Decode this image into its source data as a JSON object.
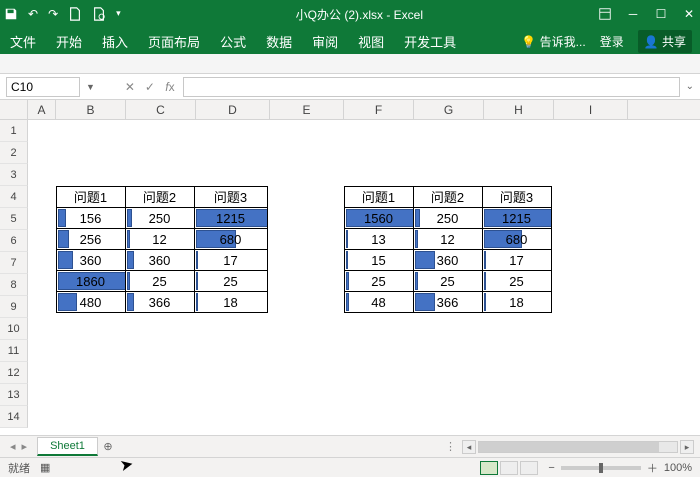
{
  "window": {
    "title": "小Q办公 (2).xlsx - Excel"
  },
  "ribbon": {
    "tabs": [
      "文件",
      "开始",
      "插入",
      "页面布局",
      "公式",
      "数据",
      "审阅",
      "视图",
      "开发工具"
    ],
    "tellme": "告诉我...",
    "login": "登录",
    "share": "共享"
  },
  "namebox": {
    "cell": "C10"
  },
  "columns": [
    "A",
    "B",
    "C",
    "D",
    "E",
    "F",
    "G",
    "H",
    "I"
  ],
  "rows": [
    "1",
    "2",
    "3",
    "4",
    "5",
    "6",
    "7",
    "8",
    "9",
    "10",
    "11",
    "12",
    "13",
    "14"
  ],
  "table1": {
    "headers": [
      "问题1",
      "问题2",
      "问题3"
    ],
    "data": [
      {
        "v": [
          156,
          250,
          1215
        ],
        "bar": [
          0.12,
          0.08,
          1.0
        ]
      },
      {
        "v": [
          256,
          12,
          680
        ],
        "bar": [
          0.16,
          0.04,
          0.56
        ]
      },
      {
        "v": [
          360,
          360,
          17
        ],
        "bar": [
          0.22,
          0.1,
          0.03
        ]
      },
      {
        "v": [
          1860,
          25,
          25
        ],
        "bar": [
          1.0,
          0.05,
          0.03
        ]
      },
      {
        "v": [
          480,
          366,
          18
        ],
        "bar": [
          0.28,
          0.1,
          0.03
        ]
      }
    ]
  },
  "table2": {
    "headers": [
      "问题1",
      "问题2",
      "问题3"
    ],
    "data": [
      {
        "v": [
          1560,
          250,
          1215
        ],
        "bar": [
          1.0,
          0.08,
          1.0
        ]
      },
      {
        "v": [
          13,
          12,
          680
        ],
        "bar": [
          0.03,
          0.04,
          0.56
        ]
      },
      {
        "v": [
          15,
          360,
          17
        ],
        "bar": [
          0.03,
          0.3,
          0.03
        ]
      },
      {
        "v": [
          25,
          25,
          25
        ],
        "bar": [
          0.04,
          0.05,
          0.03
        ]
      },
      {
        "v": [
          48,
          366,
          18
        ],
        "bar": [
          0.05,
          0.3,
          0.03
        ]
      }
    ]
  },
  "sheet": {
    "name": "Sheet1"
  },
  "status": {
    "ready": "就绪",
    "zoom": "100%"
  },
  "chart_data": [
    {
      "type": "table",
      "title": "Table 1 (B4:D9) with in-cell data bars",
      "series": [
        {
          "name": "问题1",
          "values": [
            156,
            256,
            360,
            1860,
            480
          ]
        },
        {
          "name": "问题2",
          "values": [
            250,
            12,
            360,
            25,
            366
          ]
        },
        {
          "name": "问题3",
          "values": [
            1215,
            680,
            17,
            25,
            18
          ]
        }
      ]
    },
    {
      "type": "table",
      "title": "Table 2 (F4:H9) with in-cell data bars",
      "series": [
        {
          "name": "问题1",
          "values": [
            1560,
            13,
            15,
            25,
            48
          ]
        },
        {
          "name": "问题2",
          "values": [
            250,
            12,
            360,
            25,
            366
          ]
        },
        {
          "name": "问题3",
          "values": [
            1215,
            680,
            17,
            25,
            18
          ]
        }
      ]
    }
  ]
}
